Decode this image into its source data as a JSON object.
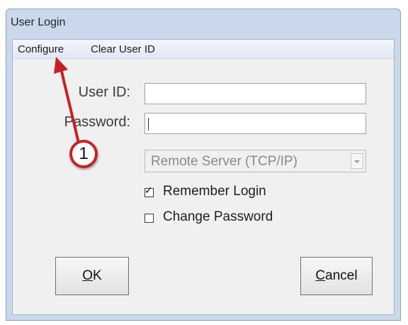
{
  "window": {
    "title": "User Login"
  },
  "menu": {
    "configure": "Configure",
    "clear_user_id": "Clear User ID"
  },
  "form": {
    "user_id_label": "User ID:",
    "user_id_value": "",
    "password_label": "Password:",
    "password_value": "",
    "server_select": "Remote Server (TCP/IP)",
    "remember_login": {
      "label": "Remember Login",
      "checked": true
    },
    "change_password": {
      "label": "Change Password",
      "checked": false
    }
  },
  "buttons": {
    "ok_accel": "O",
    "ok_rest": "K",
    "cancel_accel": "C",
    "cancel_rest": "ancel"
  },
  "annotation": {
    "badge_number": "1",
    "color": "#c52323"
  }
}
